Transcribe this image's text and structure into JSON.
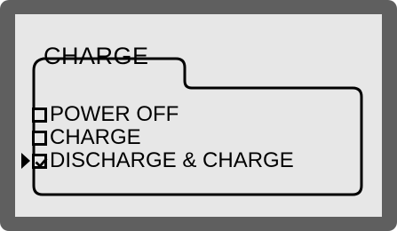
{
  "menu": {
    "title": "CHARGE",
    "items": [
      {
        "label": "POWER OFF",
        "checked": false,
        "selected": false,
        "checkbox_icon": "empty-checkbox-icon"
      },
      {
        "label": "CHARGE",
        "checked": false,
        "selected": false,
        "checkbox_icon": "empty-checkbox-icon"
      },
      {
        "label": "DISCHARGE & CHARGE",
        "checked": true,
        "selected": true,
        "checkbox_icon": "checked-checkbox-icon"
      }
    ]
  },
  "colors": {
    "bezel": "#5f5f5f",
    "screen": "#e7e7e7",
    "ink": "#000000"
  }
}
